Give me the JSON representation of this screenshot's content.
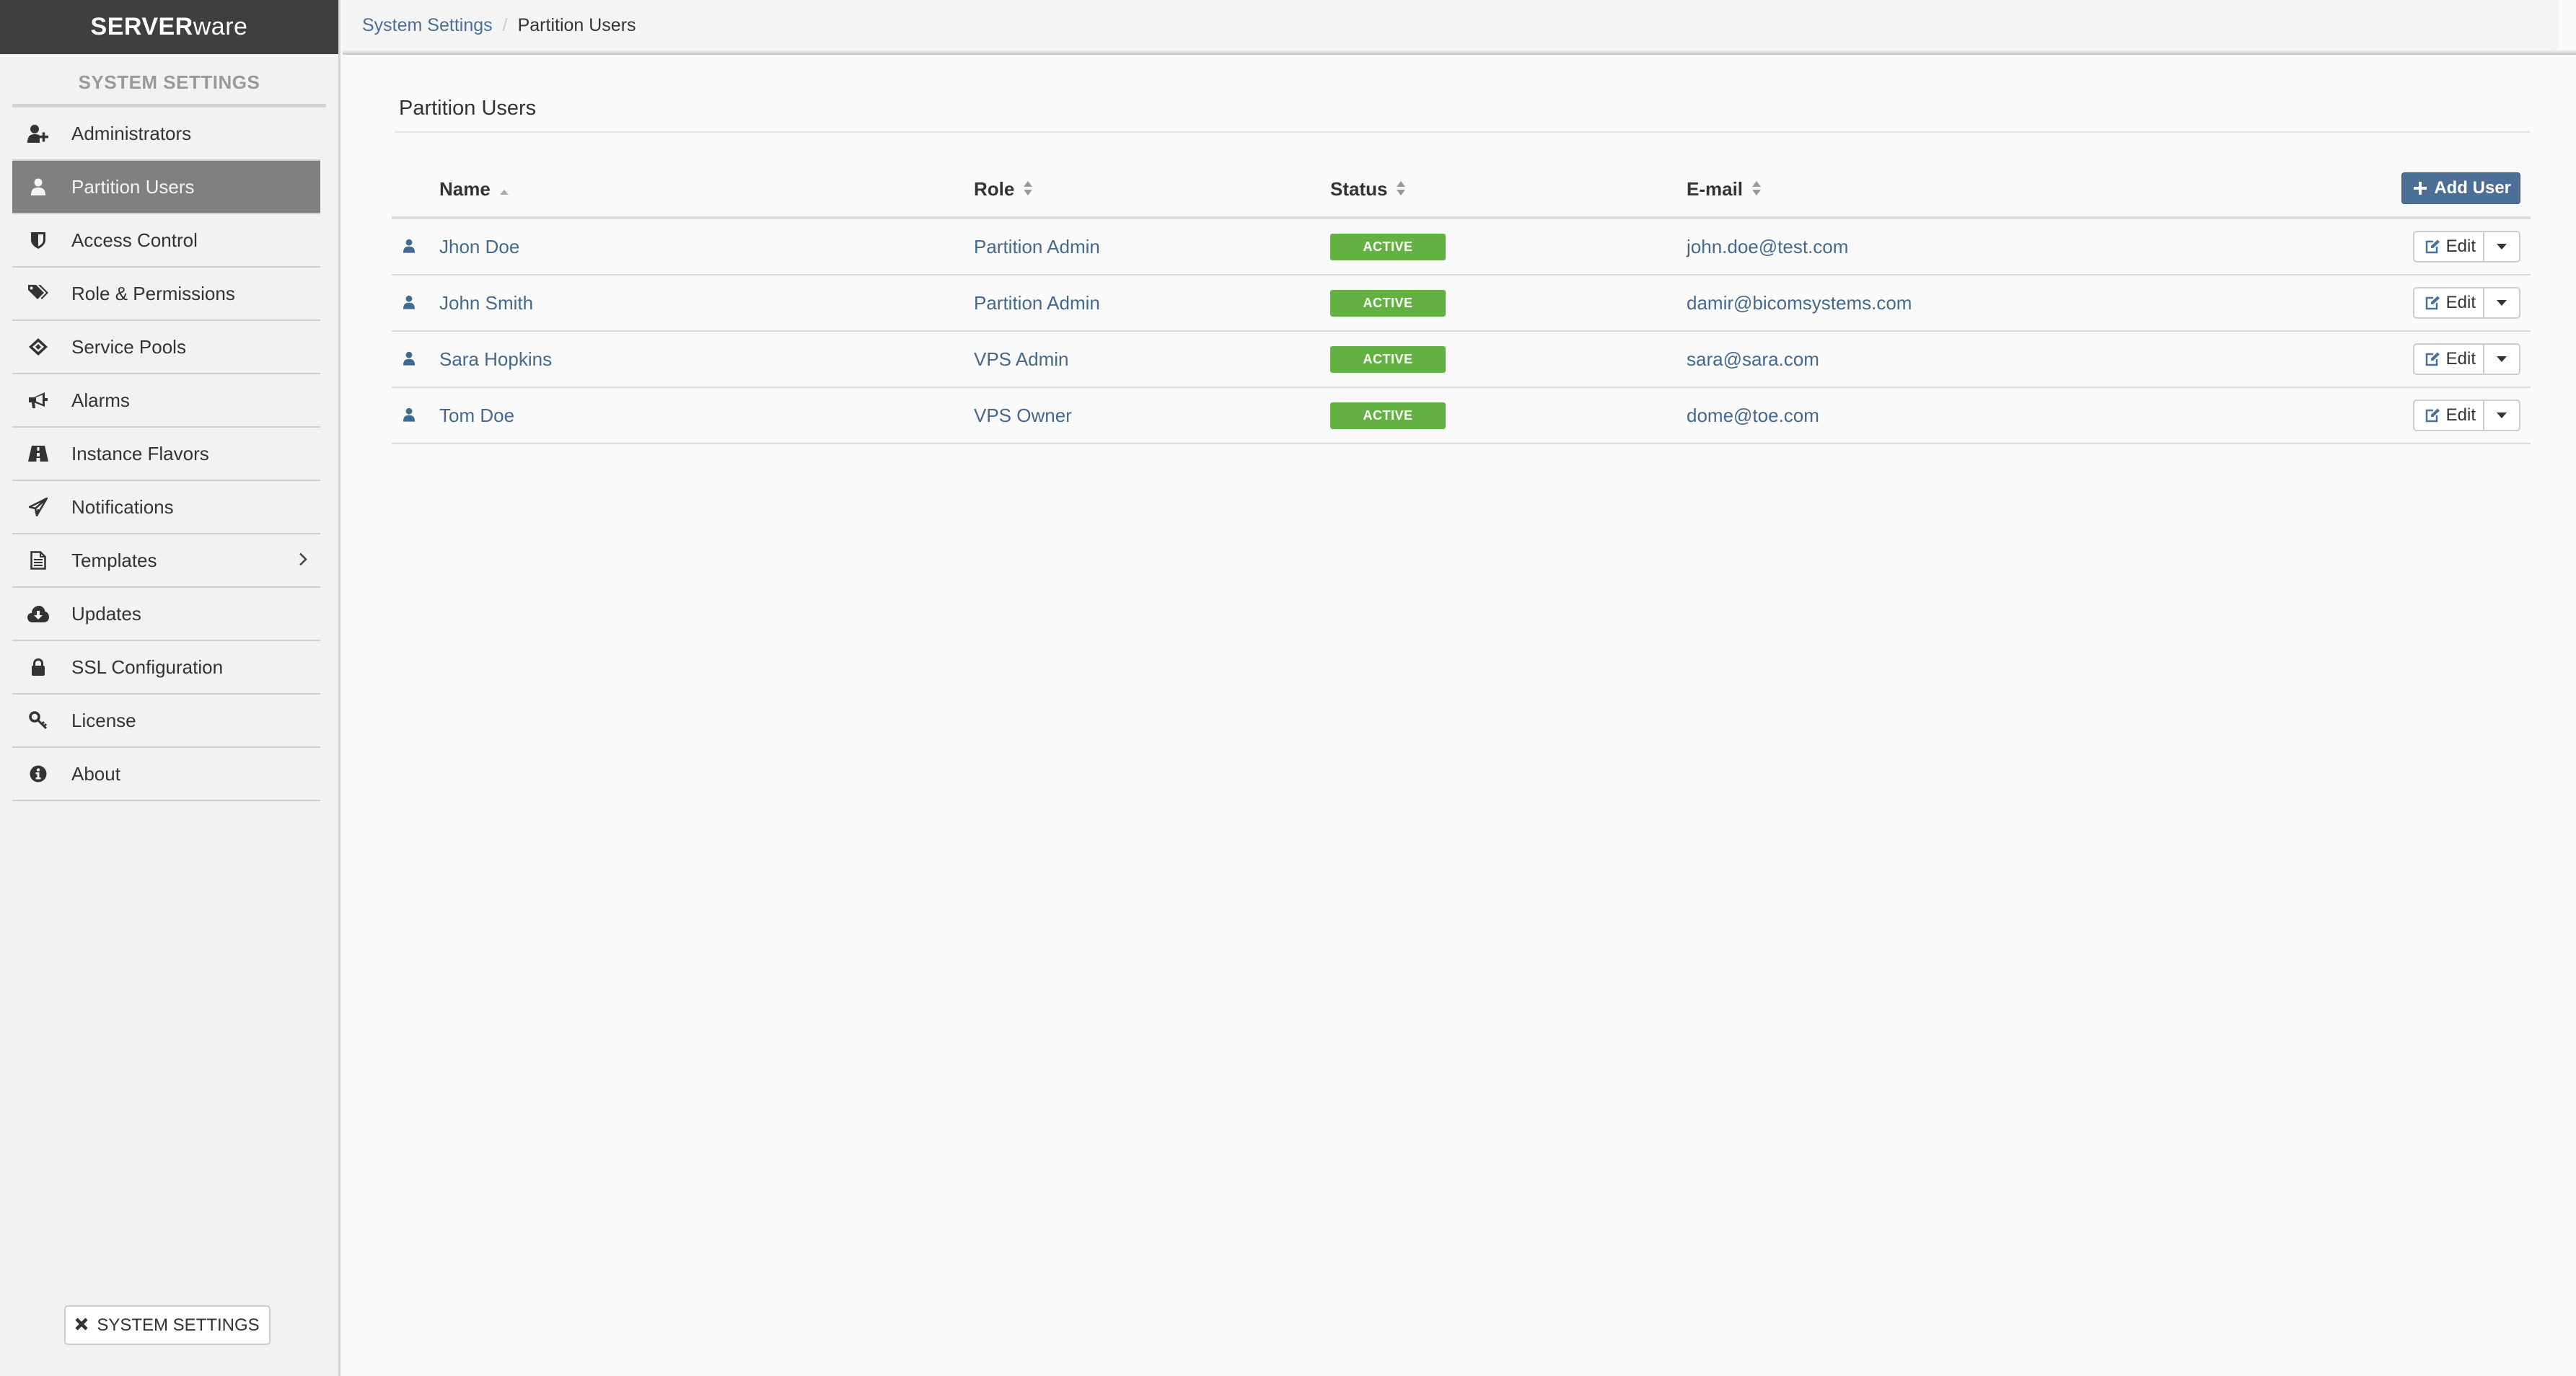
{
  "app": {
    "brand_bold": "SERVER",
    "brand_light": "ware"
  },
  "sidebar": {
    "title": "SYSTEM SETTINGS",
    "items": [
      {
        "label": "Administrators",
        "icon": "user-plus-icon",
        "active": false
      },
      {
        "label": "Partition Users",
        "icon": "user-icon",
        "active": true
      },
      {
        "label": "Access Control",
        "icon": "shield-icon",
        "active": false
      },
      {
        "label": "Role & Permissions",
        "icon": "tags-icon",
        "active": false
      },
      {
        "label": "Service Pools",
        "icon": "ticket-icon",
        "active": false
      },
      {
        "label": "Alarms",
        "icon": "bullhorn-icon",
        "active": false
      },
      {
        "label": "Instance Flavors",
        "icon": "road-icon",
        "active": false
      },
      {
        "label": "Notifications",
        "icon": "paper-plane-icon",
        "active": false
      },
      {
        "label": "Templates",
        "icon": "file-text-icon",
        "active": false,
        "has_submenu": true
      },
      {
        "label": "Updates",
        "icon": "cloud-download-icon",
        "active": false
      },
      {
        "label": "SSL Configuration",
        "icon": "lock-icon",
        "active": false
      },
      {
        "label": "License",
        "icon": "key-icon",
        "active": false
      },
      {
        "label": "About",
        "icon": "info-circle-icon",
        "active": false
      }
    ],
    "footer_button": "SYSTEM SETTINGS"
  },
  "breadcrumb": {
    "parent": "System Settings",
    "separator": "/",
    "current": "Partition Users"
  },
  "panel": {
    "title": "Partition Users",
    "add_button": "Add User",
    "columns": [
      {
        "label": "Name",
        "sort": "asc"
      },
      {
        "label": "Role",
        "sort": "none"
      },
      {
        "label": "Status",
        "sort": "none"
      },
      {
        "label": "E-mail",
        "sort": "none"
      }
    ],
    "rows": [
      {
        "name": "Jhon Doe",
        "role": "Partition Admin",
        "status": "ACTIVE",
        "email": "john.doe@test.com",
        "action": "Edit"
      },
      {
        "name": "John Smith",
        "role": "Partition Admin",
        "status": "ACTIVE",
        "email": "damir@bicomsystems.com",
        "action": "Edit"
      },
      {
        "name": "Sara Hopkins",
        "role": "VPS Admin",
        "status": "ACTIVE",
        "email": "sara@sara.com",
        "action": "Edit"
      },
      {
        "name": "Tom Doe",
        "role": "VPS Owner",
        "status": "ACTIVE",
        "email": "dome@toe.com",
        "action": "Edit"
      }
    ]
  },
  "colors": {
    "accent": "#4c6f97",
    "link": "#44688e",
    "status_active": "#62b142",
    "brand_bg": "#3f3f3f",
    "sidebar_active": "#808080"
  }
}
